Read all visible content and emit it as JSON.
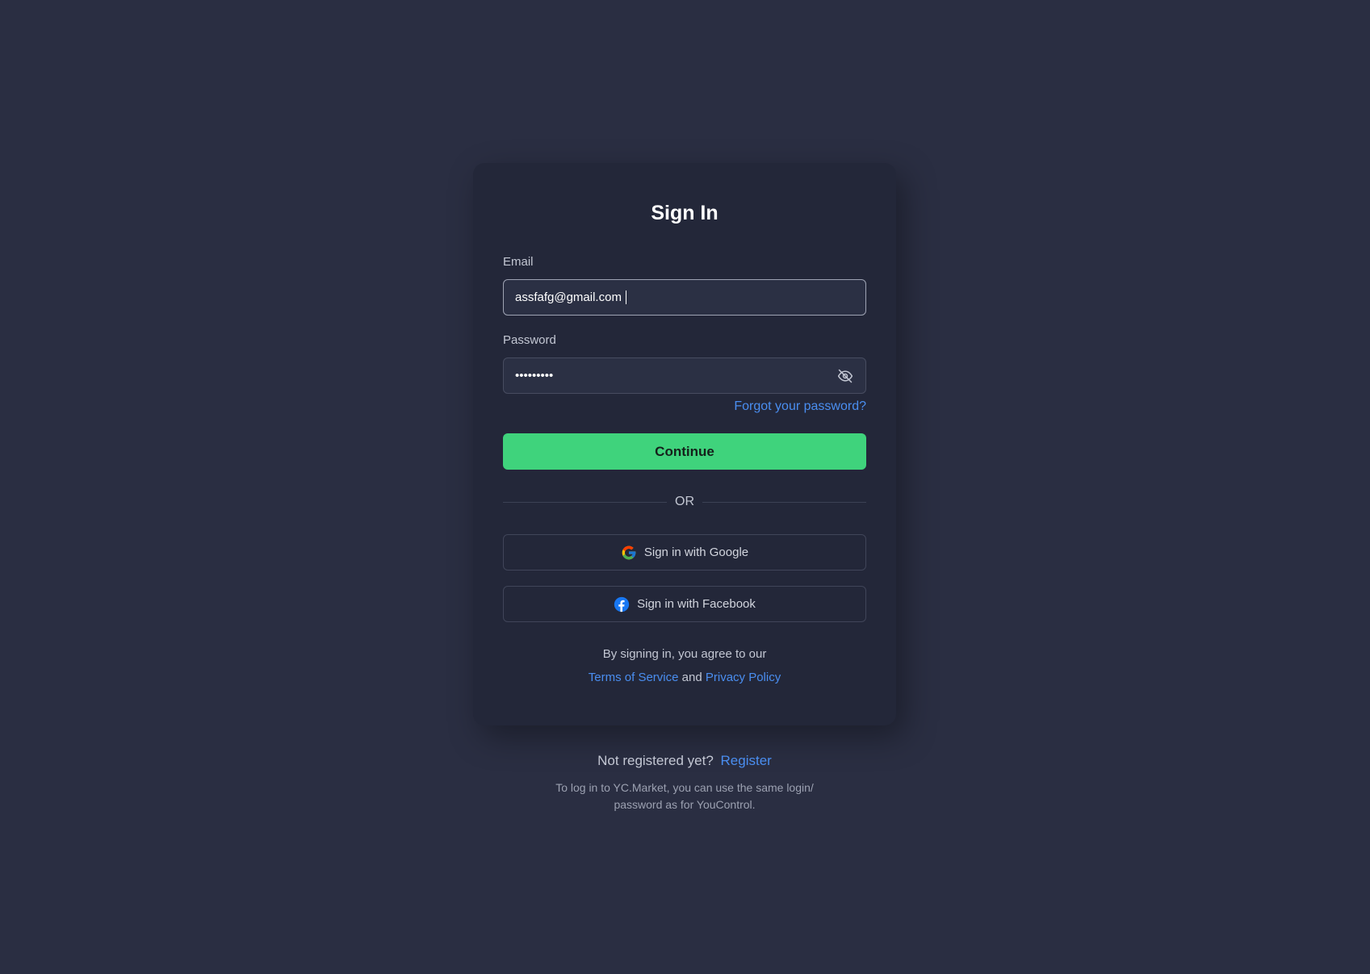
{
  "card": {
    "title": "Sign In",
    "email": {
      "label": "Email",
      "value": "assfafg@gmail.com"
    },
    "password": {
      "label": "Password",
      "masked_value": "•••••••••",
      "toggle_icon": "eye-off-icon"
    },
    "forgot_label": "Forgot your password?",
    "continue_label": "Continue",
    "divider_label": "OR",
    "google_label": "Sign in with Google",
    "facebook_label": "Sign in with Facebook",
    "agree_text": "By signing in, you agree to our",
    "terms_label": "Terms of Service",
    "and_text": "and",
    "privacy_label": "Privacy Policy"
  },
  "footer": {
    "not_registered": "Not registered yet?",
    "register_label": "Register",
    "note_line1": "To log in to YC.Market, you can use the same login/",
    "note_line2": "password as for YouControl."
  },
  "colors": {
    "background": "#2a2e42",
    "card": "#232739",
    "accent_green": "#3fd37c",
    "link_blue": "#4a8ef0"
  }
}
